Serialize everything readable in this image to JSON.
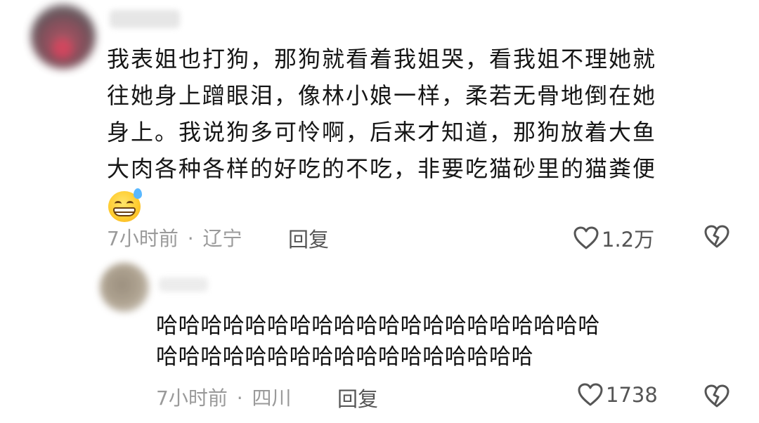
{
  "comment": {
    "lines": [
      "我表姐也打狗，那狗就看着我姐哭，看我姐不理她就",
      "往她身上蹭眼泪，像林小娘一样，柔若无骨地倒在她",
      "身上。我说狗多可怜啊，后来才知道，那狗放着大鱼",
      "大肉各种各样的好吃的不吃，非要吃猫砂里的猫粪便"
    ],
    "emoji": "grinning-face-with-sweat",
    "time": "7小时前",
    "location": "辽宁",
    "separator": "·",
    "reply_label": "回复",
    "like_count": "1.2万"
  },
  "reply": {
    "lines": [
      "哈哈哈哈哈哈哈哈哈哈哈哈哈哈哈哈哈哈哈哈",
      "哈哈哈哈哈哈哈哈哈哈哈哈哈哈哈哈哈"
    ],
    "time": "7小时前",
    "location": "四川",
    "separator": "·",
    "reply_label": "回复",
    "like_count": "1738"
  },
  "icons": {
    "like": "heart-outline-icon",
    "dislike": "broken-heart-icon"
  },
  "colors": {
    "text": "#111111",
    "meta": "#9a9a9a",
    "action": "#555555"
  }
}
